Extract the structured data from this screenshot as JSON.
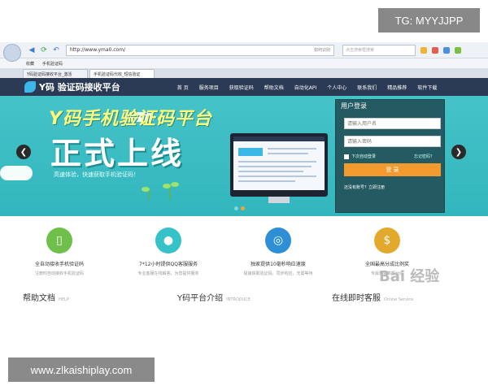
{
  "watermarks": {
    "top": "TG: MYYJJPP",
    "bottom": "www.zlkaishiplay.com"
  },
  "browser": {
    "address": "http://www.yma0.com/",
    "address_tag": "如何识别",
    "search_placeholder": "点击搜索框搜索",
    "bookmarks": [
      "收藏",
      "手机验证码"
    ],
    "tabs": [
      "Y码验证码接收平台_激活",
      "手机验证码代收_短信验证"
    ]
  },
  "site": {
    "logo": "Y码 验证码接收平台",
    "menu": [
      "首 页",
      "服务项目",
      "获取验证码",
      "帮助文档",
      "自动化API",
      "个人中心",
      "联系我们",
      "精品推荐",
      "软件下载"
    ]
  },
  "hero": {
    "title": "Y码手机验证码平台",
    "headline": "正式上线",
    "subtitle": "高速体验，快速获取手机验证码！"
  },
  "login": {
    "title": "用户登录",
    "username_placeholder": "请输入用户名",
    "password_placeholder": "请输入密码",
    "remember": "下次自动登录",
    "forgot": "忘记密码？",
    "button": "登 录",
    "register": "还没有账号？立即注册"
  },
  "features": [
    {
      "title": "全自动接收手机验证码",
      "desc": "注册时自动接收手机验证码",
      "color": "#6fbf4b",
      "icon": "phone-icon"
    },
    {
      "title": "7*12小时提供QQ客服服务",
      "desc": "专业客服在线解答，为您提供服务",
      "color": "#36c2c9",
      "icon": "qq-icon"
    },
    {
      "title": "独家提供10毫秒响应速度",
      "desc": "极速获取验证码，同步响应，无需等待",
      "color": "#2d8fd6",
      "icon": "globe-icon"
    },
    {
      "title": "全国最高分成比例奖",
      "desc": "专属佣金高额分成",
      "color": "#e3a92d",
      "icon": "money-icon"
    }
  ],
  "overlay": "Bai 经验",
  "sections": [
    {
      "title": "帮助文档",
      "en": "HELP"
    },
    {
      "title": "Y码平台介绍",
      "en": "INTRODUCE"
    },
    {
      "title": "在线即时客服",
      "en": "Online Service"
    }
  ]
}
